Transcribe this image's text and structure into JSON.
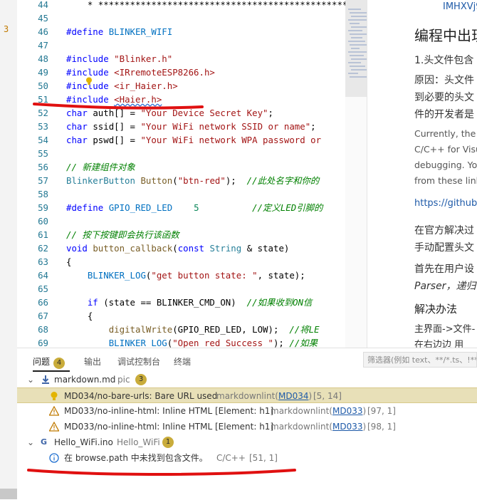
{
  "gutter": {
    "mark": "3"
  },
  "code_lines": [
    {
      "n": "44",
      "html": "<span class='plain'>    * ***************************************************</span>"
    },
    {
      "n": "45",
      "html": ""
    },
    {
      "n": "46",
      "html": "<span class='kw'>#define</span> <span class='mac'>BLINKER_WIFI</span>"
    },
    {
      "n": "47",
      "html": ""
    },
    {
      "n": "48",
      "html": "<span class='kw'>#include</span> <span class='str'>\"Blinker.h\"</span>"
    },
    {
      "n": "49",
      "html": "<span class='kw'>#include</span> <span class='str'>&lt;IRremoteESP8266.h&gt;</span>"
    },
    {
      "n": "50",
      "html": "<span class='kw'>#include</span> <span class='str'>&lt;ir_Haier.h&gt;</span>"
    },
    {
      "n": "51",
      "html": "<span class='kw'>#include</span> <span class='str squig'>&lt;Haier.h&gt;</span>"
    },
    {
      "n": "52",
      "html": "<span class='kw'>char</span> <span class='plain'>auth[] = </span><span class='str'>\"Your Device Secret Key\"</span><span class='plain'>;</span>"
    },
    {
      "n": "53",
      "html": "<span class='kw'>char</span> <span class='plain'>ssid[] = </span><span class='str'>\"Your WiFi network SSID or name\"</span><span class='plain'>;</span>"
    },
    {
      "n": "54",
      "html": "<span class='kw'>char</span> <span class='plain'>pswd[] = </span><span class='str'>\"Your WiFi network WPA password or</span>"
    },
    {
      "n": "55",
      "html": ""
    },
    {
      "n": "56",
      "html": "<span class='cm'>// 新建组件对象</span>"
    },
    {
      "n": "57",
      "html": "<span class='ty'>BlinkerButton</span> <span class='fn'>Button</span><span class='plain'>(</span><span class='str'>\"btn-red\"</span><span class='plain'>);  </span><span class='cm'>//此处名字和你的</span>"
    },
    {
      "n": "58",
      "html": ""
    },
    {
      "n": "59",
      "html": "<span class='kw'>#define</span> <span class='mac'>GPIO_RED_LED</span>    <span class='num'>5</span>          <span class='cm'>//定义LED引脚的</span>"
    },
    {
      "n": "60",
      "html": ""
    },
    {
      "n": "61",
      "html": "<span class='cm'>// 按下按键即会执行该函数</span>"
    },
    {
      "n": "62",
      "html": "<span class='kw'>void</span> <span class='fn'>button_callback</span><span class='plain'>(</span><span class='kw'>const</span> <span class='ty'>String</span> <span class='plain'>&amp; state)</span>"
    },
    {
      "n": "63",
      "html": "<span class='plain'>{</span>"
    },
    {
      "n": "64",
      "html": "<span class='plain'>    </span><span class='mac'>BLINKER_LOG</span><span class='plain'>(</span><span class='str'>\"get button state: \"</span><span class='plain'>, state);</span>"
    },
    {
      "n": "65",
      "html": ""
    },
    {
      "n": "66",
      "html": "<span class='plain'>    </span><span class='kw'>if</span><span class='plain'> (state == BLINKER_CMD_ON)  </span><span class='cm'>//如果收到ON信</span>"
    },
    {
      "n": "67",
      "html": "<span class='plain'>    {</span>"
    },
    {
      "n": "68",
      "html": "<span class='plain'>        </span><span class='fn'>digitalWrite</span><span class='plain'>(GPIO_RED_LED, LOW);  </span><span class='cm'>//将LE</span>"
    },
    {
      "n": "69",
      "html": "<span class='plain'>        </span><span class='mac'>BLINKER_LOG</span><span class='plain'>(</span><span class='str'>\"Open red Success \"</span><span class='plain'>); </span><span class='cm'>//如果</span>"
    }
  ],
  "article": {
    "header_link": "IMHXVj9",
    "heading": "编程中出现",
    "item1": "1.头文件包含",
    "p1_a": "原因：头文件",
    "p1_b": "到必要的头文",
    "p1_c": "件的开发者是",
    "p2_a": "Currently, the V",
    "p2_b": "C/C++ for Visu",
    "p2_c": "debugging. Yo",
    "p2_d": "from these link",
    "link": "https://github.",
    "p3_a": "在官方解决过",
    "p3_b": "手动配置头文",
    "p4_a": "首先在用户设",
    "p4_b": "Parser，递归",
    "p5_a": "解决办法",
    "p6_a": "主界面->文件-",
    "p6_b": "在右边边  用"
  },
  "panel": {
    "tabs": [
      {
        "label": "问题",
        "badge": "4",
        "active": true
      },
      {
        "label": "输出"
      },
      {
        "label": "调试控制台"
      },
      {
        "label": "终端"
      }
    ],
    "filter_placeholder": "筛选器(例如 text、**/*.ts、!**",
    "groups": [
      {
        "file": "markdown.md",
        "folder": "pic",
        "count": "3",
        "items": [
          {
            "severity": "hint",
            "message": "MD034/no-bare-urls: Bare URL used",
            "source": "markdownlint(",
            "rule": "MD034",
            "close": ")",
            "pos": "[5, 14]"
          },
          {
            "severity": "warning",
            "message": "MD033/no-inline-html: Inline HTML [Element: h1]",
            "source": "markdownlint(",
            "rule": "MD033",
            "close": ")",
            "pos": "[97, 1]"
          },
          {
            "severity": "warning",
            "message": "MD033/no-inline-html: Inline HTML [Element: h1]",
            "source": "markdownlint(",
            "rule": "MD033",
            "close": ")",
            "pos": "[98, 1]"
          }
        ]
      },
      {
        "file": "Hello_WiFi.ino",
        "folder": "Hello_WiFi",
        "count": "1",
        "items": [
          {
            "severity": "info",
            "message": "在 browse.path 中未找到包含文件。",
            "source": "C/C++",
            "pos": "[51, 1]"
          }
        ]
      }
    ]
  },
  "colors": {
    "accent": "#1e5aa8",
    "badge": "#c9ac3b",
    "warning": "#c07a00",
    "annotation": "#e01010"
  }
}
